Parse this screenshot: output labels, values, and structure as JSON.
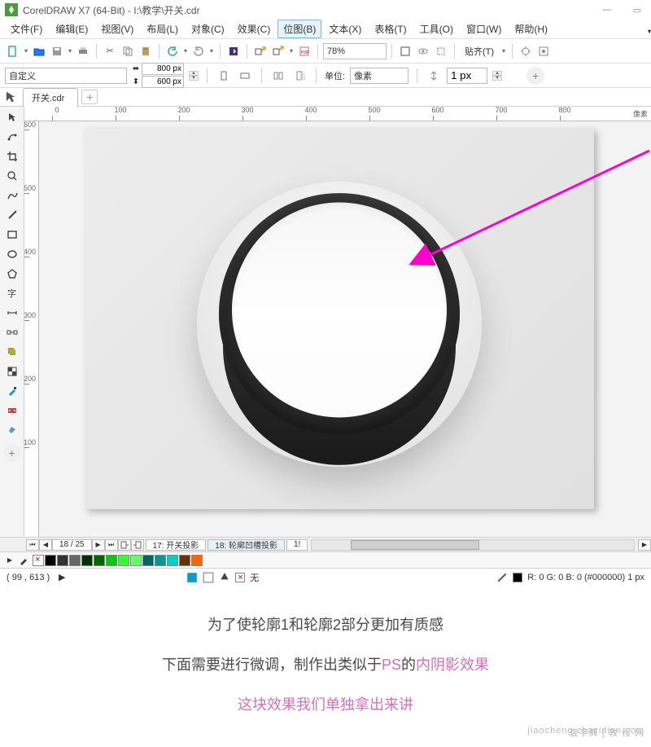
{
  "title": "CorelDRAW X7 (64-Bit) - I:\\教学\\开关.cdr",
  "menu": {
    "file": "文件(F)",
    "edit": "编辑(E)",
    "view": "视图(V)",
    "layout": "布局(L)",
    "object": "对象(C)",
    "effects": "效果(C)",
    "bitmap": "位图(B)",
    "text": "文本(X)",
    "table": "表格(T)",
    "tools": "工具(O)",
    "window": "窗口(W)",
    "help": "帮助(H)"
  },
  "toolbar": {
    "zoom": "78%",
    "snap_label": "贴齐(T)"
  },
  "propbar": {
    "preset": "自定义",
    "width": "800 px",
    "height": "600 px",
    "unit_label": "单位:",
    "unit_value": "像素",
    "nudge": "1 px"
  },
  "tabs": {
    "file": "开关.cdr"
  },
  "ruler": {
    "unit_label": "像素",
    "h_ticks": [
      "0",
      "100",
      "200",
      "300",
      "400",
      "500",
      "600",
      "700",
      "800"
    ],
    "v_ticks": [
      "600",
      "500",
      "400",
      "300",
      "200",
      "100"
    ]
  },
  "pages": {
    "nav_label": "18 / 25",
    "tab_a": "17: 开关投影",
    "tab_b": "18: 轮廓凹槽投影",
    "tab_c": "1!"
  },
  "palette_colors": [
    "#000000",
    "#333333",
    "#666666",
    "#003300",
    "#006600",
    "#00cc00",
    "#33ff33",
    "#66ff66",
    "#006666",
    "#009999",
    "#00cccc",
    "#663300",
    "#ff6600"
  ],
  "status": {
    "coords": "( 99   , 613 )",
    "fill_none": "无",
    "stroke_info": "R: 0 G: 0 B: 0 (#000000)  1 px"
  },
  "caption": {
    "line1": "为了使轮廓1和轮廓2部分更加有质感",
    "line2a": "下面需要进行微调，制作出类似于",
    "line2b": "PS",
    "line2c": "的",
    "line2d": "内阴影效果",
    "line3": "这块效果我们单独拿出来讲"
  },
  "watermark": {
    "main": "查字典 [ 教 程 网",
    "sub": "jiaocheng.chazidian.com"
  }
}
